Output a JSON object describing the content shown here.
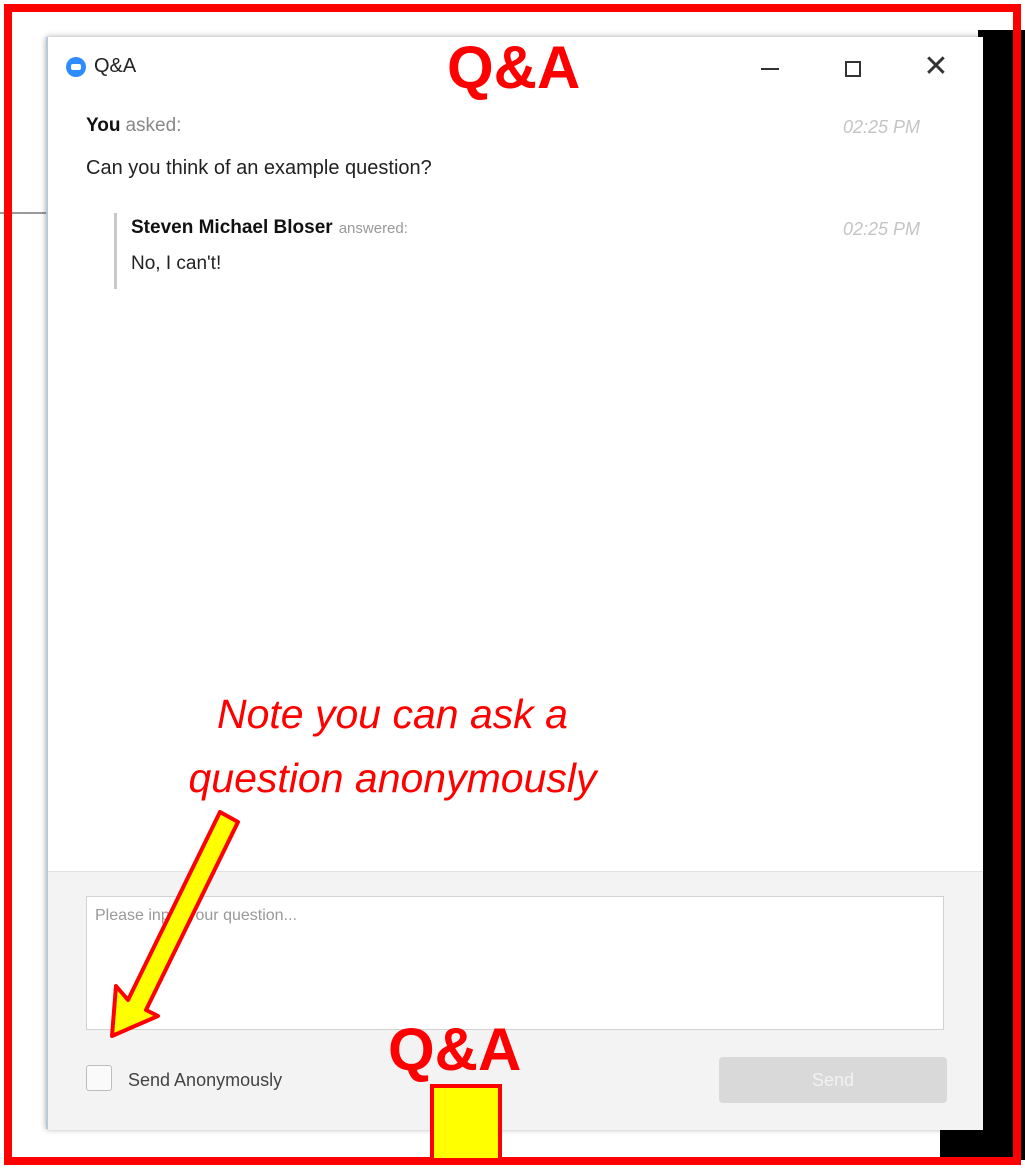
{
  "window": {
    "title": "Q&A",
    "controls": {
      "minimize": "minimize-icon",
      "maximize": "maximize-icon",
      "close": "close-icon"
    }
  },
  "question": {
    "asker": "You",
    "verb": "asked:",
    "time": "02:25 PM",
    "text": "Can you think of an example question?"
  },
  "answer": {
    "answerer": "Steven Michael Bloser",
    "verb": "answered:",
    "time": "02:25 PM",
    "text": "No, I can't!"
  },
  "footer": {
    "input_placeholder": "Please input your question...",
    "anonymous_label": "Send Anonymously",
    "send_label": "Send"
  },
  "annotations": {
    "top_label": "Q&A",
    "bottom_label": "Q&A",
    "note_line1": "Note you can ask a",
    "note_line2": "question anonymously"
  },
  "colors": {
    "annotation_red": "#ff0000",
    "arrow_fill": "#ffff00",
    "logo_blue": "#2d8cff",
    "send_disabled": "#d9d9d9"
  }
}
